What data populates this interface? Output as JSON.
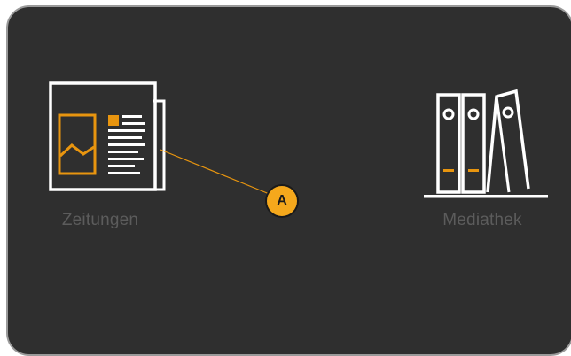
{
  "tiles": {
    "zeitungen": {
      "label": "Zeitungen",
      "icon": "newspaper-icon"
    },
    "mediathek": {
      "label": "Mediathek",
      "icon": "binders-icon"
    }
  },
  "callout": {
    "label": "A"
  },
  "colors": {
    "panel_background": "#2f2f2f",
    "panel_border": "#9a9a9a",
    "icon_stroke": "#ffffff",
    "icon_accent": "#e8950f",
    "label_text": "#5c5c5c",
    "callout_fill": "#f5a81c"
  }
}
